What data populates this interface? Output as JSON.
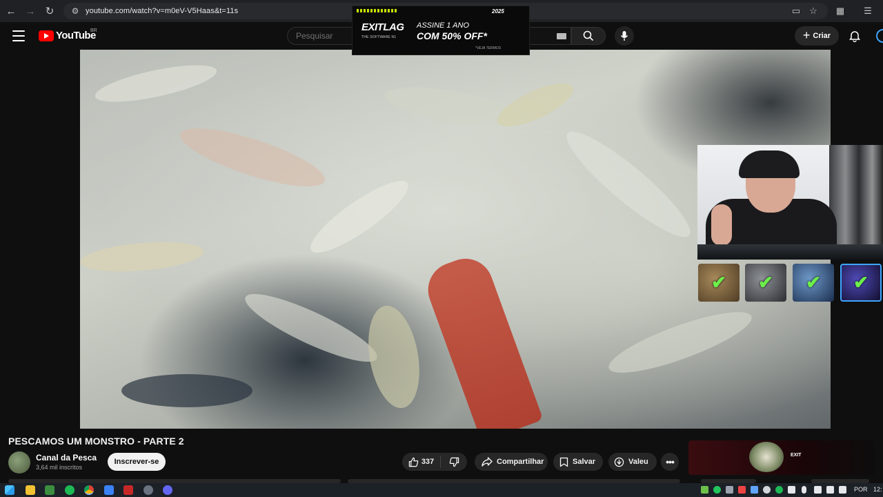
{
  "browser": {
    "url": "youtube.com/watch?v=m0eV-V5Haas&t=11s"
  },
  "youtube": {
    "logo_text": "YouTube",
    "country_code": "BR",
    "search_placeholder": "Pesquisar",
    "create_label": "Criar"
  },
  "ad_banner": {
    "year": "2025",
    "brand": "EXITLAG",
    "brand_tagline": "THE SOFTWARE N1",
    "line1": "ASSINE 1 ANO",
    "line2": "COM 50% OFF*",
    "terms": "*VEJA TERMOS"
  },
  "video": {
    "title": "PESCAMOS UM MONSTRO - PARTE 2",
    "channel_name": "Canal da Pesca",
    "subscribers": "3,64 mil inscritos",
    "subscribe_label": "Inscrever-se",
    "like_count": "337",
    "share_label": "Compartilhar",
    "save_label": "Salvar",
    "thanks_label": "Valeu",
    "achievements_completed": 4
  },
  "side_ad": {
    "text": "EXIT"
  },
  "taskbar": {
    "language": "POR",
    "clock": "12:"
  },
  "colors": {
    "youtube_red": "#ff0000",
    "background": "#0f0f0f",
    "pill": "#272727",
    "check_green": "#6cf04a",
    "ad_lime": "#c7e000"
  }
}
